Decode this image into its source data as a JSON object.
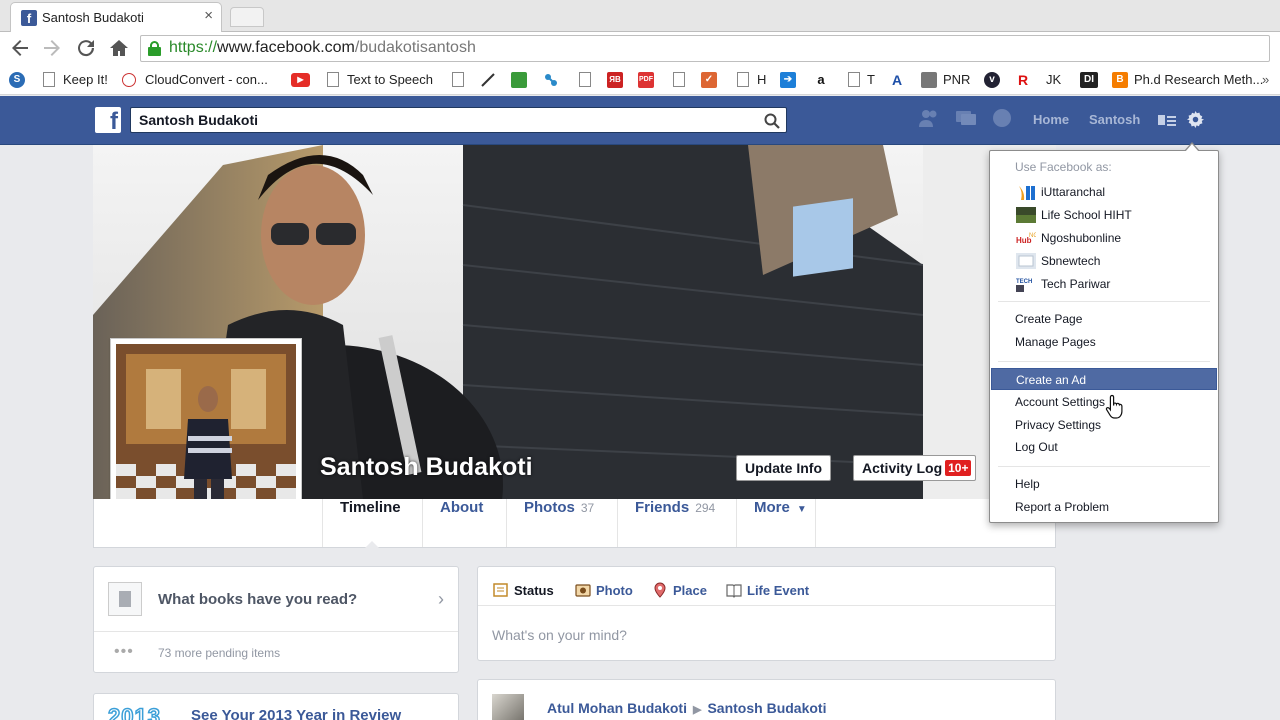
{
  "browser": {
    "tab_title": "Santosh Budakoti",
    "tab_favicon": "f",
    "url_scheme": "https://",
    "url_host": "www.facebook.com",
    "url_path": "/budakotisantosh",
    "bookmarks": {
      "keepit": "Keep It!",
      "cloudconvert": "CloudConvert - con...",
      "tts": "Text to Speech",
      "h": "H",
      "t": "T",
      "pnr": "PNR",
      "jk": "JK",
      "di": "DI",
      "phd": "Ph.d Research Meth..."
    }
  },
  "fb": {
    "logo": "f",
    "search_value": "Santosh Budakoti",
    "nav_home": "Home",
    "nav_user": "Santosh",
    "brand_color": "#3b5998"
  },
  "profile": {
    "name": "Santosh Budakoti",
    "update_info": "Update Info",
    "activity_log": "Activity Log",
    "activity_badge": "10+",
    "tabs": {
      "timeline": "Timeline",
      "about": "About",
      "photos": "Photos",
      "photos_count": "37",
      "friends": "Friends",
      "friends_count": "294",
      "more": "More"
    }
  },
  "left": {
    "books_question": "What books have you read?",
    "pending": "73 more pending items",
    "review_year": "2013",
    "review_title": "See Your 2013 Year in Review"
  },
  "composer": {
    "status": "Status",
    "photo": "Photo",
    "place": "Place",
    "life_event": "Life Event",
    "placeholder": "What's on your mind?"
  },
  "story": {
    "author": "Atul Mohan Budakoti",
    "target": "Santosh Budakoti"
  },
  "menu": {
    "header": "Use Facebook as:",
    "pages": [
      "iUttaranchal",
      "Life School HIHT",
      "Ngoshubonline",
      "Sbnewtech",
      "Tech Pariwar"
    ],
    "create_page": "Create Page",
    "manage_pages": "Manage Pages",
    "create_ad": "Create an Ad",
    "account_settings": "Account Settings",
    "privacy_settings": "Privacy Settings",
    "log_out": "Log Out",
    "help": "Help",
    "report": "Report a Problem",
    "highlight_color": "#4f6aa3"
  }
}
